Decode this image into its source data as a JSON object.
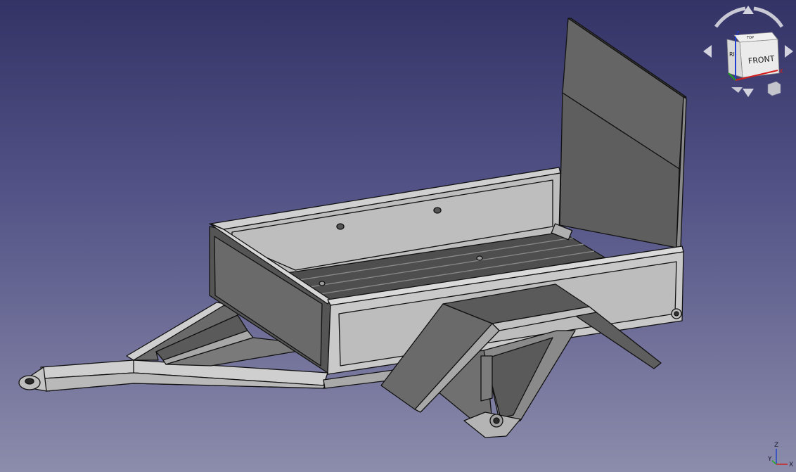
{
  "viewport": {
    "background_top": "#333366",
    "background_bottom": "#8c8cac",
    "model_stroke": "#111111",
    "light_face": "#c8c8c8",
    "mid_face": "#aaaaaa",
    "dark_face": "#5c5c5c"
  },
  "navigation_cube": {
    "front_label": "FRONT",
    "side_label": "RI",
    "top_label": "TOP",
    "axis_z_label": "Z",
    "axis_x_label": "X",
    "axis_y_label": "Y",
    "axis_x_color": "#d41f1f",
    "axis_y_color": "#1fa01f",
    "axis_z_color": "#1f3fd4"
  },
  "axis_indicator": {
    "z_label": "Z",
    "x_label": "X",
    "y_label": "Y",
    "x_color": "#cc2222",
    "y_color": "#22aa22",
    "z_color": "#2244cc"
  }
}
